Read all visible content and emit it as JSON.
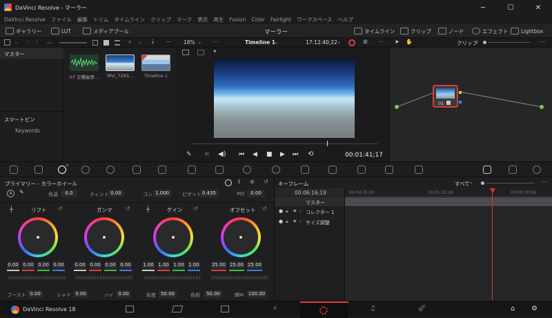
{
  "window": {
    "title": "DaVinci Resolve - マーラー"
  },
  "menu": [
    "DaVinci Resolve",
    "ファイル",
    "編集",
    "トリム",
    "タイムライン",
    "クリップ",
    "マーク",
    "表示",
    "再生",
    "Fusion",
    "Color",
    "Fairlight",
    "ワークスペース",
    "ヘルプ"
  ],
  "toolbar": {
    "gallery": "ギャラリー",
    "lut": "LUT",
    "mediapool": "メディアプール",
    "project_title": "マーラー",
    "timeline": "タイムライン",
    "clips": "クリップ",
    "nodes": "ノード",
    "effects": "エフェクト",
    "lightbox": "Lightbox"
  },
  "secondbar": {
    "ellipsis": "...",
    "zoom": "18%",
    "timeline_name": "Timeline 1",
    "timecode": "17:12:40;22",
    "clip_mode": "クリップ"
  },
  "mediapool": {
    "root": "マスター",
    "smartbins": "スマートビン",
    "keywords": "Keywords",
    "clips": [
      {
        "label": "07 交響曲第..."
      },
      {
        "label": "MVI_7293..."
      },
      {
        "label": "Timeline 1"
      }
    ]
  },
  "viewer": {
    "timecode": "00:01:41;17"
  },
  "nodes": {
    "node_label": "01"
  },
  "primaries": {
    "title": "プライマリー - カラーホイール",
    "top_fields": [
      {
        "label": "色温",
        "value": "0.0"
      },
      {
        "label": "ティント",
        "value": "0.00"
      },
      {
        "label": "コン",
        "value": "1.000"
      },
      {
        "label": "ピボット",
        "value": "0.435"
      },
      {
        "label": "MD",
        "value": "0.00"
      }
    ],
    "wheels": [
      {
        "name": "リフト",
        "values": [
          "0.00",
          "0.00",
          "0.00",
          "0.00"
        ]
      },
      {
        "name": "ガンマ",
        "values": [
          "0.00",
          "0.00",
          "0.00",
          "0.00"
        ]
      },
      {
        "name": "ゲイン",
        "values": [
          "1.00",
          "1.00",
          "1.00",
          "1.00"
        ]
      },
      {
        "name": "オフセット",
        "values": [
          "25.00",
          "25.00",
          "25.00"
        ]
      }
    ],
    "bottom_fields": [
      {
        "label": "ブースト",
        "value": "0.00"
      },
      {
        "label": "シャド",
        "value": "0.00"
      },
      {
        "label": "ハイ",
        "value": "0.00"
      },
      {
        "label": "彩度",
        "value": "50.00"
      },
      {
        "label": "色相",
        "value": "50.00"
      },
      {
        "label": "輝M",
        "value": "100.00"
      }
    ]
  },
  "keyframes": {
    "title": "キーフレーム",
    "filter": "すべて",
    "timecode": "00:06:16;19",
    "ruler": [
      "00:04:35;00",
      "00:05:32;18",
      "00:06:30;06"
    ],
    "tracks": [
      {
        "label": "マスター"
      },
      {
        "label": "コレクター 1"
      },
      {
        "label": "サイズ調整"
      }
    ]
  },
  "pagebar": {
    "app_label": "DaVinci Resolve 18"
  },
  "colors": {
    "accent": "#e0443c",
    "playhead": "#d9352d",
    "highlight_blue": "#3d8df0"
  }
}
